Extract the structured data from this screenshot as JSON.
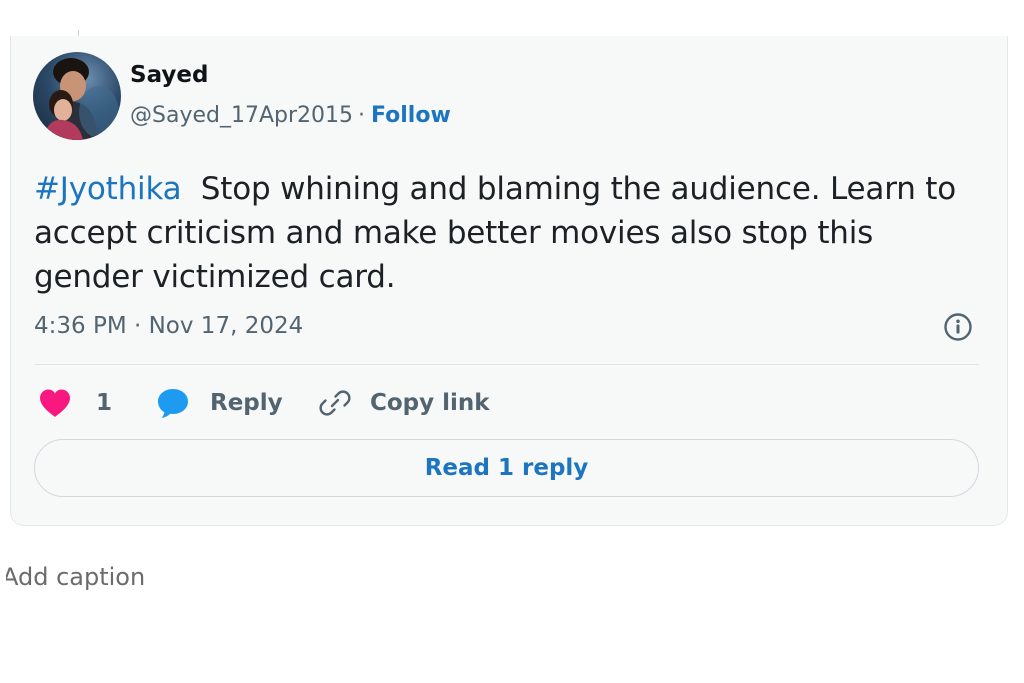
{
  "tweet": {
    "author_name": "Sayed",
    "author_handle": "@Sayed_17Apr2015",
    "separator": "·",
    "follow_label": "Follow",
    "hashtag": "#Jyothika",
    "text": "Stop whining and blaming the audience. Learn to accept criticism and make better movies also stop this gender victimized card.",
    "timestamp": "4:36 PM · Nov 17, 2024",
    "like_count": "1",
    "reply_label": "Reply",
    "copy_link_label": "Copy link",
    "read_replies_label": "Read 1 reply"
  },
  "caption": {
    "placeholder": "Add caption"
  },
  "icons": {
    "like": "heart-icon",
    "reply": "speech-bubble-icon",
    "copy_link": "link-icon",
    "info": "info-icon"
  },
  "colors": {
    "accent_blue": "#1d75bf",
    "heart_pink": "#f91880",
    "reply_blue": "#1d9bf0",
    "muted_text": "#536471",
    "card_background": "#f7f9f9"
  }
}
